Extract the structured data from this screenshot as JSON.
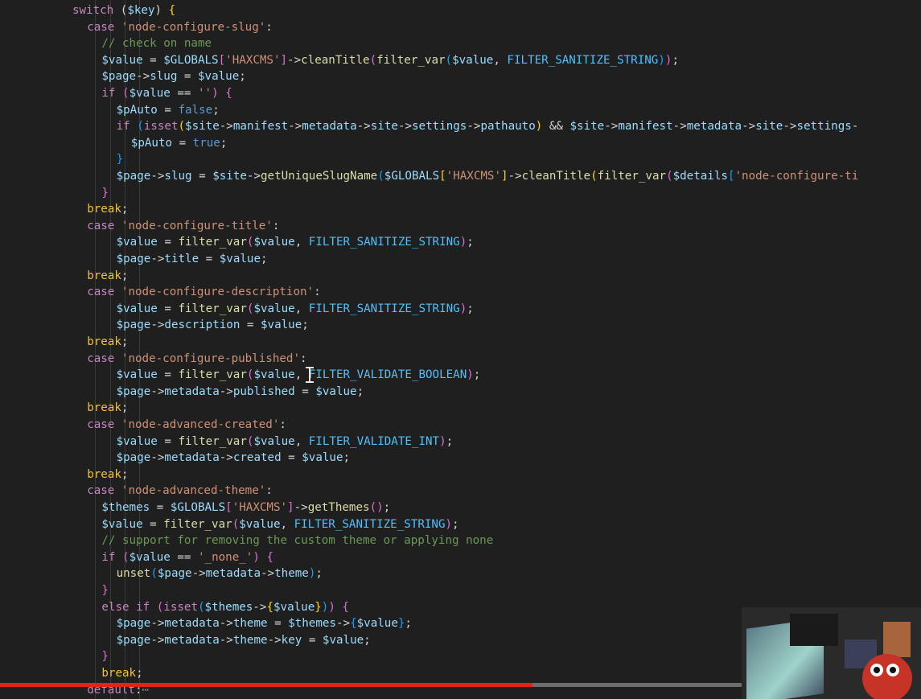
{
  "editor": {
    "lines": [
      {
        "indent": 0,
        "tokens": [
          [
            "k",
            "switch"
          ],
          [
            "o",
            " ("
          ],
          [
            "v",
            "$key"
          ],
          [
            "o",
            ") "
          ],
          [
            "p1",
            "{"
          ]
        ]
      },
      {
        "indent": 1,
        "tokens": [
          [
            "k",
            "case "
          ],
          [
            "s",
            "'node-configure-slug'"
          ],
          [
            "o",
            ":"
          ]
        ]
      },
      {
        "indent": 2,
        "tokens": [
          [
            "c",
            "// check on name"
          ]
        ]
      },
      {
        "indent": 2,
        "tokens": [
          [
            "v",
            "$value"
          ],
          [
            "o",
            " = "
          ],
          [
            "v",
            "$GLOBALS"
          ],
          [
            "p2",
            "["
          ],
          [
            "s",
            "'HAXCMS'"
          ],
          [
            "p2",
            "]"
          ],
          [
            "o",
            "->"
          ],
          [
            "f",
            "cleanTitle"
          ],
          [
            "p2",
            "("
          ],
          [
            "f",
            "filter_var"
          ],
          [
            "p3",
            "("
          ],
          [
            "v",
            "$value"
          ],
          [
            "o",
            ", "
          ],
          [
            "cn",
            "FILTER_SANITIZE_STRING"
          ],
          [
            "p3",
            ")"
          ],
          [
            "p2",
            ")"
          ],
          [
            "o",
            ";"
          ]
        ]
      },
      {
        "indent": 2,
        "tokens": [
          [
            "v",
            "$page"
          ],
          [
            "o",
            "->"
          ],
          [
            "v",
            "slug"
          ],
          [
            "o",
            " = "
          ],
          [
            "v",
            "$value"
          ],
          [
            "o",
            ";"
          ]
        ]
      },
      {
        "indent": 2,
        "tokens": [
          [
            "k",
            "if"
          ],
          [
            "o",
            " "
          ],
          [
            "p2",
            "("
          ],
          [
            "v",
            "$value"
          ],
          [
            "o",
            " == "
          ],
          [
            "s",
            "''"
          ],
          [
            "p2",
            ")"
          ],
          [
            "o",
            " "
          ],
          [
            "p2",
            "{"
          ]
        ]
      },
      {
        "indent": 3,
        "tokens": [
          [
            "v",
            "$pAuto"
          ],
          [
            "o",
            " = "
          ],
          [
            "bo",
            "false"
          ],
          [
            "o",
            ";"
          ]
        ]
      },
      {
        "indent": 3,
        "tokens": [
          [
            "k",
            "if"
          ],
          [
            "o",
            " "
          ],
          [
            "p3",
            "("
          ],
          [
            "k",
            "isset"
          ],
          [
            "p1",
            "("
          ],
          [
            "v",
            "$site"
          ],
          [
            "o",
            "->"
          ],
          [
            "v",
            "manifest"
          ],
          [
            "o",
            "->"
          ],
          [
            "v",
            "metadata"
          ],
          [
            "o",
            "->"
          ],
          [
            "v",
            "site"
          ],
          [
            "o",
            "->"
          ],
          [
            "v",
            "settings"
          ],
          [
            "o",
            "->"
          ],
          [
            "v",
            "pathauto"
          ],
          [
            "p1",
            ")"
          ],
          [
            "o",
            " && "
          ],
          [
            "v",
            "$site"
          ],
          [
            "o",
            "->"
          ],
          [
            "v",
            "manifest"
          ],
          [
            "o",
            "->"
          ],
          [
            "v",
            "metadata"
          ],
          [
            "o",
            "->"
          ],
          [
            "v",
            "site"
          ],
          [
            "o",
            "->"
          ],
          [
            "v",
            "settings"
          ],
          [
            "o",
            "-"
          ]
        ]
      },
      {
        "indent": 4,
        "tokens": [
          [
            "v",
            "$pAuto"
          ],
          [
            "o",
            " = "
          ],
          [
            "bo",
            "true"
          ],
          [
            "o",
            ";"
          ]
        ]
      },
      {
        "indent": 3,
        "tokens": [
          [
            "p3",
            "}"
          ]
        ]
      },
      {
        "indent": 3,
        "tokens": [
          [
            "v",
            "$page"
          ],
          [
            "o",
            "->"
          ],
          [
            "v",
            "slug"
          ],
          [
            "o",
            " = "
          ],
          [
            "v",
            "$site"
          ],
          [
            "o",
            "->"
          ],
          [
            "f",
            "getUniqueSlugName"
          ],
          [
            "p3",
            "("
          ],
          [
            "v",
            "$GLOBALS"
          ],
          [
            "p1",
            "["
          ],
          [
            "s",
            "'HAXCMS'"
          ],
          [
            "p1",
            "]"
          ],
          [
            "o",
            "->"
          ],
          [
            "f",
            "cleanTitle"
          ],
          [
            "p1",
            "("
          ],
          [
            "f",
            "filter_var"
          ],
          [
            "p2",
            "("
          ],
          [
            "v",
            "$details"
          ],
          [
            "p3",
            "["
          ],
          [
            "s",
            "'node-configure-ti"
          ]
        ]
      },
      {
        "indent": 2,
        "tokens": [
          [
            "p2",
            "}"
          ]
        ]
      },
      {
        "indent": 1,
        "tokens": [
          [
            "br",
            "break"
          ],
          [
            "o",
            ";"
          ]
        ]
      },
      {
        "indent": 1,
        "tokens": [
          [
            "k",
            "case "
          ],
          [
            "s",
            "'node-configure-title'"
          ],
          [
            "o",
            ":"
          ]
        ]
      },
      {
        "indent": 3,
        "tokens": [
          [
            "v",
            "$value"
          ],
          [
            "o",
            " = "
          ],
          [
            "f",
            "filter_var"
          ],
          [
            "p2",
            "("
          ],
          [
            "v",
            "$value"
          ],
          [
            "o",
            ", "
          ],
          [
            "cn",
            "FILTER_SANITIZE_STRING"
          ],
          [
            "p2",
            ")"
          ],
          [
            "o",
            ";"
          ]
        ]
      },
      {
        "indent": 3,
        "tokens": [
          [
            "v",
            "$page"
          ],
          [
            "o",
            "->"
          ],
          [
            "v",
            "title"
          ],
          [
            "o",
            " = "
          ],
          [
            "v",
            "$value"
          ],
          [
            "o",
            ";"
          ]
        ]
      },
      {
        "indent": 1,
        "tokens": [
          [
            "br",
            "break"
          ],
          [
            "o",
            ";"
          ]
        ]
      },
      {
        "indent": 1,
        "tokens": [
          [
            "k",
            "case "
          ],
          [
            "s",
            "'node-configure-description'"
          ],
          [
            "o",
            ":"
          ]
        ]
      },
      {
        "indent": 3,
        "tokens": [
          [
            "v",
            "$value"
          ],
          [
            "o",
            " = "
          ],
          [
            "f",
            "filter_var"
          ],
          [
            "p2",
            "("
          ],
          [
            "v",
            "$value"
          ],
          [
            "o",
            ", "
          ],
          [
            "cn",
            "FILTER_SANITIZE_STRING"
          ],
          [
            "p2",
            ")"
          ],
          [
            "o",
            ";"
          ]
        ]
      },
      {
        "indent": 3,
        "tokens": [
          [
            "v",
            "$page"
          ],
          [
            "o",
            "->"
          ],
          [
            "v",
            "description"
          ],
          [
            "o",
            " = "
          ],
          [
            "v",
            "$value"
          ],
          [
            "o",
            ";"
          ]
        ]
      },
      {
        "indent": 1,
        "tokens": [
          [
            "br",
            "break"
          ],
          [
            "o",
            ";"
          ]
        ]
      },
      {
        "indent": 1,
        "tokens": [
          [
            "k",
            "case "
          ],
          [
            "s",
            "'node-configure-published'"
          ],
          [
            "o",
            ":"
          ]
        ]
      },
      {
        "indent": 3,
        "tokens": [
          [
            "v",
            "$value"
          ],
          [
            "o",
            " = "
          ],
          [
            "f",
            "filter_var"
          ],
          [
            "p2",
            "("
          ],
          [
            "v",
            "$value"
          ],
          [
            "o",
            ", "
          ],
          [
            "cn",
            "FILTER_VALIDATE_BOOLEAN"
          ],
          [
            "p2",
            ")"
          ],
          [
            "o",
            ";"
          ]
        ]
      },
      {
        "indent": 3,
        "tokens": [
          [
            "v",
            "$page"
          ],
          [
            "o",
            "->"
          ],
          [
            "v",
            "metadata"
          ],
          [
            "o",
            "->"
          ],
          [
            "v",
            "published"
          ],
          [
            "o",
            " = "
          ],
          [
            "v",
            "$value"
          ],
          [
            "o",
            ";"
          ]
        ]
      },
      {
        "indent": 1,
        "tokens": [
          [
            "br",
            "break"
          ],
          [
            "o",
            ";"
          ]
        ]
      },
      {
        "indent": 1,
        "tokens": [
          [
            "k",
            "case "
          ],
          [
            "s",
            "'node-advanced-created'"
          ],
          [
            "o",
            ":"
          ]
        ]
      },
      {
        "indent": 3,
        "tokens": [
          [
            "v",
            "$value"
          ],
          [
            "o",
            " = "
          ],
          [
            "f",
            "filter_var"
          ],
          [
            "p2",
            "("
          ],
          [
            "v",
            "$value"
          ],
          [
            "o",
            ", "
          ],
          [
            "cn",
            "FILTER_VALIDATE_INT"
          ],
          [
            "p2",
            ")"
          ],
          [
            "o",
            ";"
          ]
        ]
      },
      {
        "indent": 3,
        "tokens": [
          [
            "v",
            "$page"
          ],
          [
            "o",
            "->"
          ],
          [
            "v",
            "metadata"
          ],
          [
            "o",
            "->"
          ],
          [
            "v",
            "created"
          ],
          [
            "o",
            " = "
          ],
          [
            "v",
            "$value"
          ],
          [
            "o",
            ";"
          ]
        ]
      },
      {
        "indent": 1,
        "tokens": [
          [
            "br",
            "break"
          ],
          [
            "o",
            ";"
          ]
        ]
      },
      {
        "indent": 1,
        "tokens": [
          [
            "k",
            "case "
          ],
          [
            "s",
            "'node-advanced-theme'"
          ],
          [
            "o",
            ":"
          ]
        ]
      },
      {
        "indent": 2,
        "tokens": [
          [
            "v",
            "$themes"
          ],
          [
            "o",
            " = "
          ],
          [
            "v",
            "$GLOBALS"
          ],
          [
            "p2",
            "["
          ],
          [
            "s",
            "'HAXCMS'"
          ],
          [
            "p2",
            "]"
          ],
          [
            "o",
            "->"
          ],
          [
            "f",
            "getThemes"
          ],
          [
            "p2",
            "()"
          ],
          [
            "o",
            ";"
          ]
        ]
      },
      {
        "indent": 2,
        "tokens": [
          [
            "v",
            "$value"
          ],
          [
            "o",
            " = "
          ],
          [
            "f",
            "filter_var"
          ],
          [
            "p2",
            "("
          ],
          [
            "v",
            "$value"
          ],
          [
            "o",
            ", "
          ],
          [
            "cn",
            "FILTER_SANITIZE_STRING"
          ],
          [
            "p2",
            ")"
          ],
          [
            "o",
            ";"
          ]
        ]
      },
      {
        "indent": 2,
        "tokens": [
          [
            "c",
            "// support for removing the custom theme or applying none"
          ]
        ]
      },
      {
        "indent": 2,
        "tokens": [
          [
            "k",
            "if"
          ],
          [
            "o",
            " "
          ],
          [
            "p2",
            "("
          ],
          [
            "v",
            "$value"
          ],
          [
            "o",
            " == "
          ],
          [
            "s",
            "'_none_'"
          ],
          [
            "p2",
            ")"
          ],
          [
            "o",
            " "
          ],
          [
            "p2",
            "{"
          ]
        ]
      },
      {
        "indent": 3,
        "tokens": [
          [
            "f",
            "unset"
          ],
          [
            "p3",
            "("
          ],
          [
            "v",
            "$page"
          ],
          [
            "o",
            "->"
          ],
          [
            "v",
            "metadata"
          ],
          [
            "o",
            "->"
          ],
          [
            "v",
            "theme"
          ],
          [
            "p3",
            ")"
          ],
          [
            "o",
            ";"
          ]
        ]
      },
      {
        "indent": 2,
        "tokens": [
          [
            "p2",
            "}"
          ]
        ]
      },
      {
        "indent": 2,
        "tokens": [
          [
            "k",
            "else if"
          ],
          [
            "o",
            " "
          ],
          [
            "p2",
            "("
          ],
          [
            "k",
            "isset"
          ],
          [
            "p3",
            "("
          ],
          [
            "v",
            "$themes"
          ],
          [
            "o",
            "->"
          ],
          [
            "p1",
            "{"
          ],
          [
            "v",
            "$value"
          ],
          [
            "p1",
            "}"
          ],
          [
            "p3",
            ")"
          ],
          [
            "p2",
            ")"
          ],
          [
            "o",
            " "
          ],
          [
            "p2",
            "{"
          ]
        ]
      },
      {
        "indent": 3,
        "tokens": [
          [
            "v",
            "$page"
          ],
          [
            "o",
            "->"
          ],
          [
            "v",
            "metadata"
          ],
          [
            "o",
            "->"
          ],
          [
            "v",
            "theme"
          ],
          [
            "o",
            " = "
          ],
          [
            "v",
            "$themes"
          ],
          [
            "o",
            "->"
          ],
          [
            "p3",
            "{"
          ],
          [
            "v",
            "$value"
          ],
          [
            "p3",
            "}"
          ],
          [
            "o",
            ";"
          ]
        ]
      },
      {
        "indent": 3,
        "tokens": [
          [
            "v",
            "$page"
          ],
          [
            "o",
            "->"
          ],
          [
            "v",
            "metadata"
          ],
          [
            "o",
            "->"
          ],
          [
            "v",
            "theme"
          ],
          [
            "o",
            "->"
          ],
          [
            "v",
            "key"
          ],
          [
            "o",
            " = "
          ],
          [
            "v",
            "$value"
          ],
          [
            "o",
            ";"
          ]
        ]
      },
      {
        "indent": 2,
        "tokens": [
          [
            "p2",
            "}"
          ]
        ]
      },
      {
        "indent": 2,
        "tokens": [
          [
            "br",
            "break"
          ],
          [
            "o",
            ";"
          ]
        ]
      },
      {
        "indent": 1,
        "tokens": [
          [
            "df",
            "default"
          ],
          [
            "o",
            ":"
          ],
          [
            "fold",
            "⋯"
          ]
        ]
      }
    ]
  },
  "video": {
    "progress_fraction": 0.578
  },
  "colors": {
    "background": "#1f1f1f",
    "progress": "#e62117"
  }
}
